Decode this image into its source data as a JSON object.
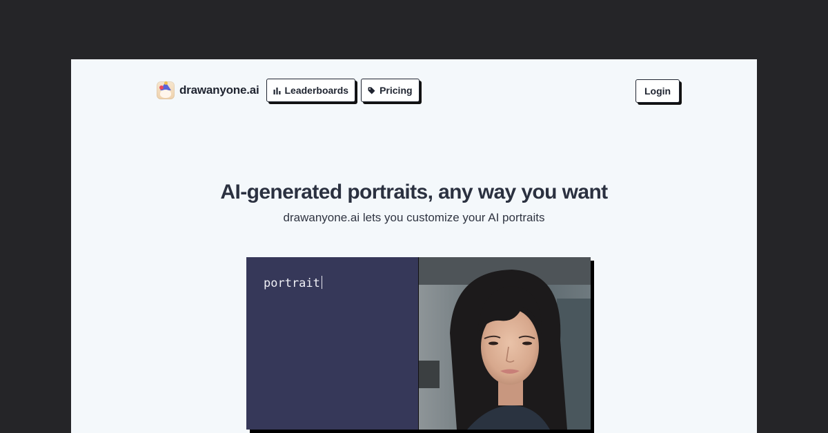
{
  "header": {
    "brand": "drawanyone.ai",
    "nav": [
      {
        "label": "Leaderboards",
        "icon": "bar-chart-icon"
      },
      {
        "label": "Pricing",
        "icon": "tag-icon"
      }
    ],
    "login_label": "Login"
  },
  "hero": {
    "title": "AI-generated portraits, any way you want",
    "subtitle": "drawanyone.ai lets you customize your AI portraits"
  },
  "demo": {
    "prompt_text": "portrait",
    "image_alt": "portrait photo"
  },
  "colors": {
    "page_bg": "#f4f8fb",
    "outer_bg": "#252528",
    "prompt_panel": "#363859",
    "text_dark": "#1f2430"
  }
}
